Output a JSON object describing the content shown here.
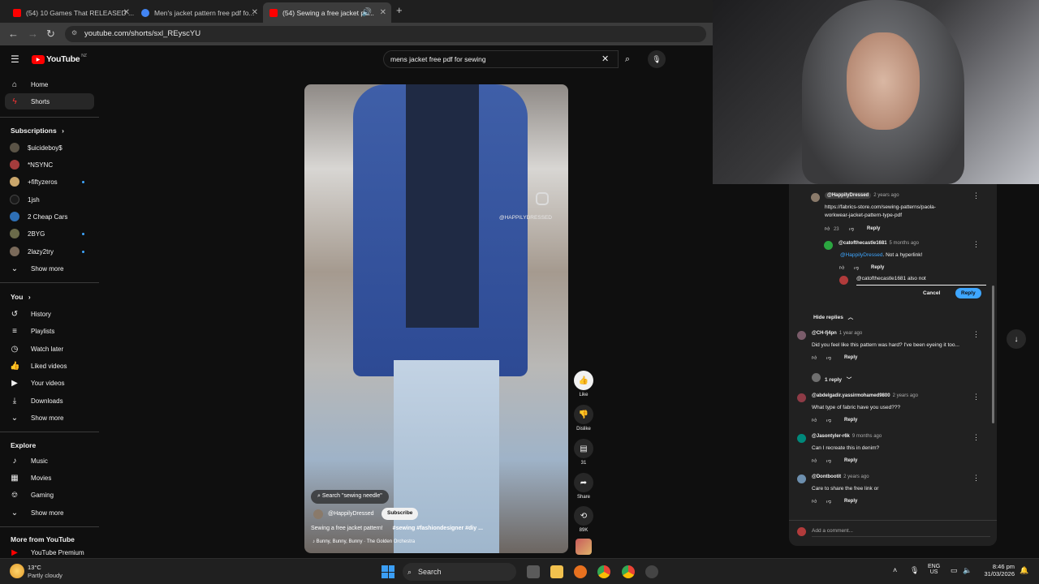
{
  "browser": {
    "tabs": [
      {
        "title": "(54) 10 Games That RELEASED ..."
      },
      {
        "title": "Men's jacket pattern free pdf fo..."
      },
      {
        "title": "(54) Sewing a free jacket pa..."
      }
    ],
    "url": "youtube.com/shorts/sxl_REyscYU"
  },
  "youtube": {
    "logo_text": "YouTube",
    "region": "NZ",
    "search_value": "mens jacket free pdf for sewing",
    "sidebar": {
      "main": [
        {
          "label": "Home"
        },
        {
          "label": "Shorts"
        }
      ],
      "subscriptions_heading": "Subscriptions",
      "subscriptions": [
        {
          "label": "$uicideboy$"
        },
        {
          "label": "*NSYNC"
        },
        {
          "label": "+fiftyzeros"
        },
        {
          "label": "1jsh"
        },
        {
          "label": "2 Cheap Cars"
        },
        {
          "label": "2BYG"
        },
        {
          "label": "2lazy2try"
        }
      ],
      "show_more": "Show more",
      "you_heading": "You",
      "you": [
        {
          "label": "History"
        },
        {
          "label": "Playlists"
        },
        {
          "label": "Watch later"
        },
        {
          "label": "Liked videos"
        },
        {
          "label": "Your videos"
        },
        {
          "label": "Downloads"
        }
      ],
      "explore_heading": "Explore",
      "explore": [
        {
          "label": "Music"
        },
        {
          "label": "Movies"
        },
        {
          "label": "Gaming"
        }
      ],
      "more_heading": "More from YouTube",
      "more": [
        {
          "label": "YouTube Premium"
        }
      ]
    },
    "short": {
      "watermark": "@HAPPILYDRESSED",
      "search_chip": "Search \"sewing needle\"",
      "channel": "@HappilyDressed",
      "subscribe": "Subscribe",
      "title": "Sewing a free jacket pattern!",
      "hashtags": "#sewing #fashiondesigner #diy ...",
      "sound": "Bunny, Bunny, Bunny · The Golden Orchestra"
    },
    "actions": {
      "like": "Like",
      "dislike": "Dislike",
      "comments": "31",
      "share": "Share",
      "remix": "89K"
    },
    "comments": {
      "thread_parent": {
        "user": "@HappilyDressed",
        "time": "2 years ago",
        "text_line1": "https://fabrics-store.com/sewing-patterns/paola-",
        "text_line2": "workwear-jacket-pattern-type-pdf",
        "likes": "23",
        "reply": "Reply"
      },
      "thread_reply": {
        "user": "@catofthecastle1681",
        "time": "5 months ago",
        "mention": "@HappilyDressed",
        "text": ". Not a hyperlink!",
        "reply": "Reply"
      },
      "reply_input_value": "@catofthecastle1681  also not",
      "cancel": "Cancel",
      "reply_button": "Reply",
      "hide_replies": "Hide replies",
      "list": [
        {
          "user": "@CH-fj4pn",
          "time": "1 year ago",
          "text": "Did you feel like this pattern was hard? I've been eyeing it too...",
          "reply": "Reply",
          "replies": "1 reply"
        },
        {
          "user": "@abdelgadir.yassirmohamed9800",
          "time": "2 years ago",
          "text": "What type of fabric have you used???",
          "reply": "Reply"
        },
        {
          "user": "@Jasontyler-r6k",
          "time": "9 months ago",
          "text": "Can I recreate this in denim?",
          "reply": "Reply"
        },
        {
          "user": "@Dontbootit",
          "time": "2 years ago",
          "text": "Care to share the free link or",
          "reply": "Reply"
        }
      ],
      "add_placeholder": "Add a comment..."
    }
  },
  "taskbar": {
    "temp": "13°C",
    "weather": "Partly cloudy",
    "search": "Search",
    "lang1": "ENG",
    "lang2": "US",
    "time": "8:46 pm",
    "date": "31/03/2026"
  },
  "colors": {
    "yt_red": "#ff0000",
    "accent_blue": "#3ea6ff",
    "reply_button": "#3ea6ff"
  }
}
